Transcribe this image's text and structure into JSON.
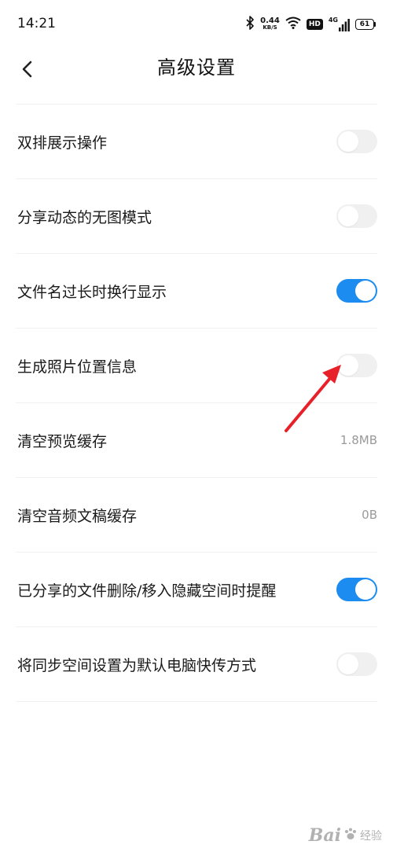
{
  "status_bar": {
    "time": "14:21",
    "net_speed_value": "0.44",
    "net_speed_unit": "KB/S",
    "hd": "HD",
    "network": "4G",
    "battery": "61"
  },
  "header": {
    "title": "高级设置"
  },
  "settings": [
    {
      "label": "双排展示操作",
      "type": "toggle",
      "on": false
    },
    {
      "label": "分享动态的无图模式",
      "type": "toggle",
      "on": false
    },
    {
      "label": "文件名过长时换行显示",
      "type": "toggle",
      "on": true
    },
    {
      "label": "生成照片位置信息",
      "type": "toggle",
      "on": false
    },
    {
      "label": "清空预览缓存",
      "type": "value",
      "value": "1.8MB"
    },
    {
      "label": "清空音频文稿缓存",
      "type": "value",
      "value": "0B"
    },
    {
      "label": "已分享的文件删除/移入隐藏空间时提醒",
      "type": "toggle",
      "on": true
    },
    {
      "label": "将同步空间设置为默认电脑快传方式",
      "type": "toggle",
      "on": false
    }
  ],
  "colors": {
    "accent": "#1d8cf0",
    "toggle_off": "#f0f0f0",
    "annotation": "#e8202a"
  },
  "watermark": {
    "brand": "Bai",
    "suffix": "经验"
  }
}
